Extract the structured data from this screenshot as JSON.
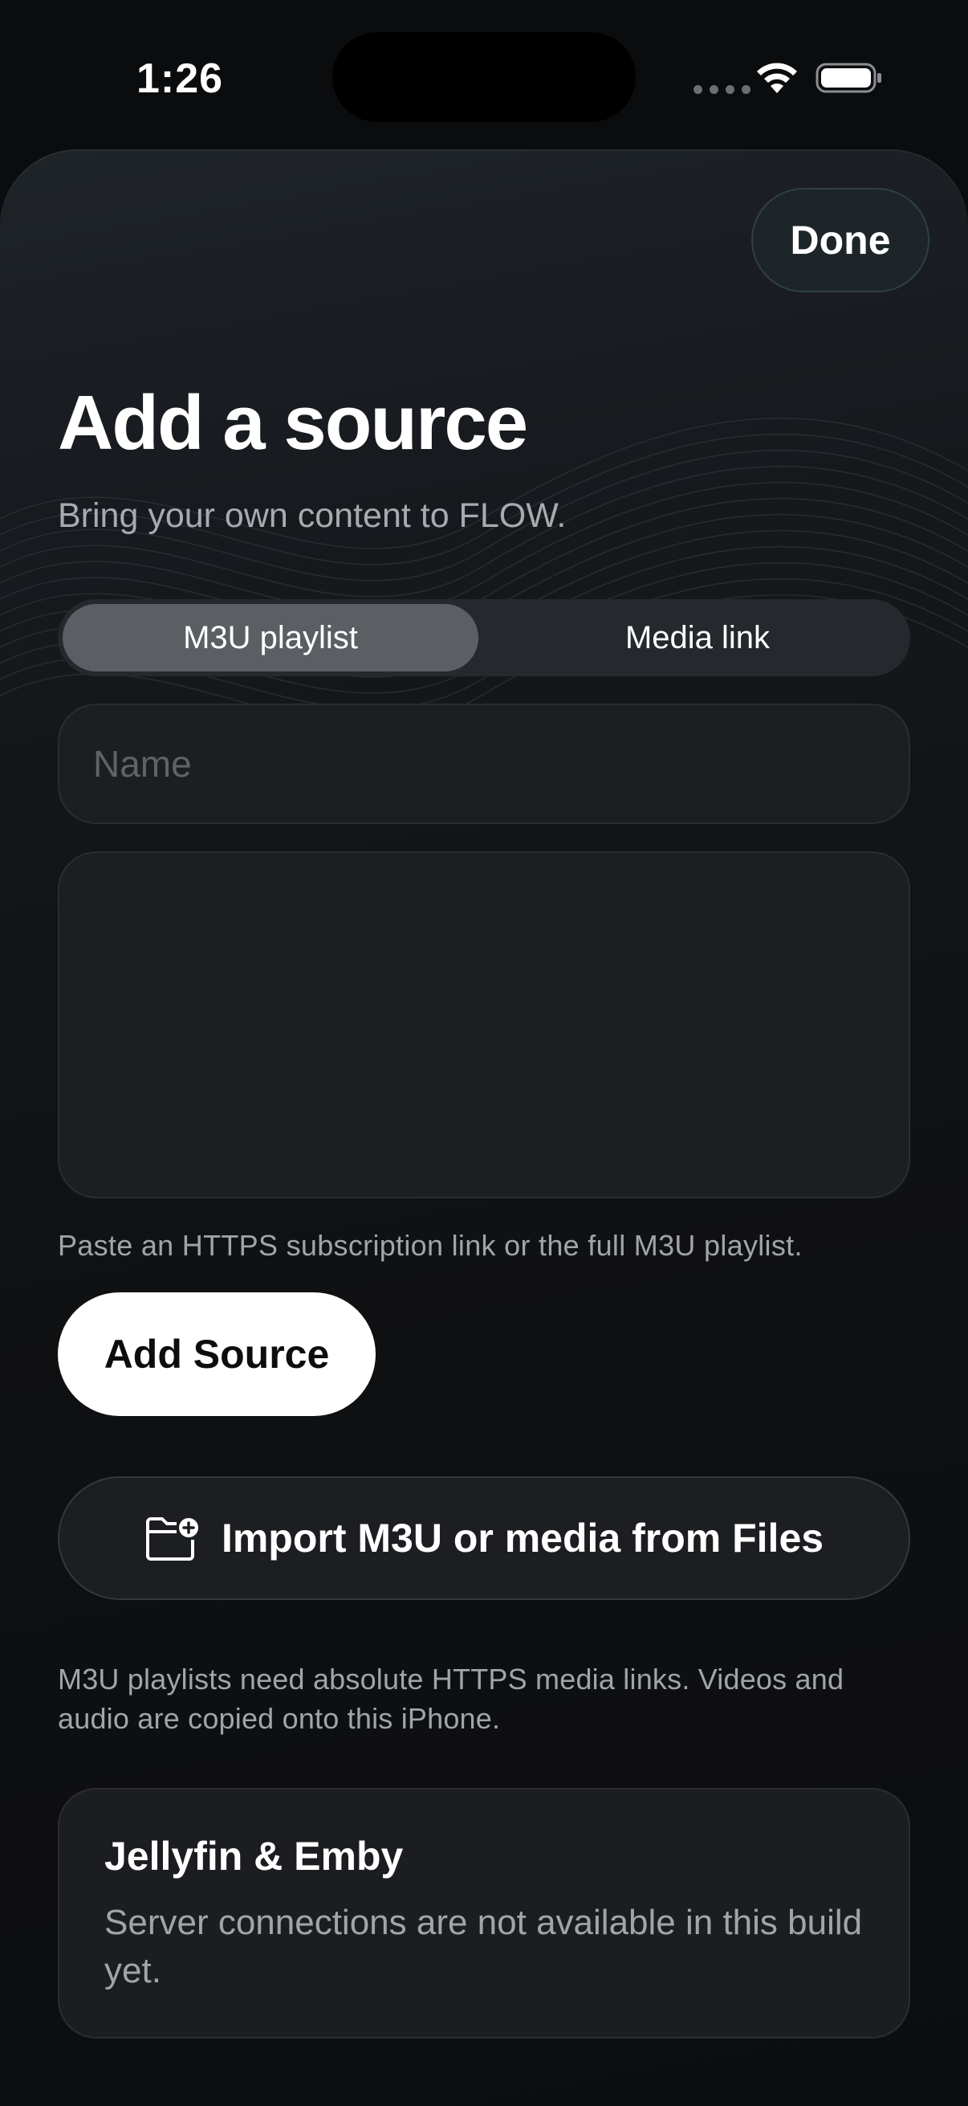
{
  "status_bar": {
    "time": "1:26"
  },
  "sheet": {
    "done_label": "Done",
    "title": "Add a source",
    "subtitle": "Bring your own content to FLOW.",
    "segments": [
      {
        "label": "M3U playlist",
        "selected": true
      },
      {
        "label": "Media link",
        "selected": false
      }
    ],
    "name_field": {
      "placeholder": "Name",
      "value": ""
    },
    "url_field": {
      "value": ""
    },
    "hint": "Paste an HTTPS subscription link or the full M3U playlist.",
    "add_source_label": "Add Source",
    "import_label": "Import M3U or media from Files",
    "note": "M3U playlists need absolute HTTPS media links. Videos and audio are copied onto this iPhone.",
    "card": {
      "title": "Jellyfin & Emby",
      "body": "Server connections are not available in this build yet."
    }
  },
  "icons": {
    "wifi": "wifi-icon",
    "battery": "battery-icon",
    "import": "folder-plus-icon"
  },
  "colors": {
    "background": "#0b0c0e",
    "done_border": "#2f4148",
    "primary_button": "#ffffff",
    "segment_active": "#5b5e63"
  }
}
